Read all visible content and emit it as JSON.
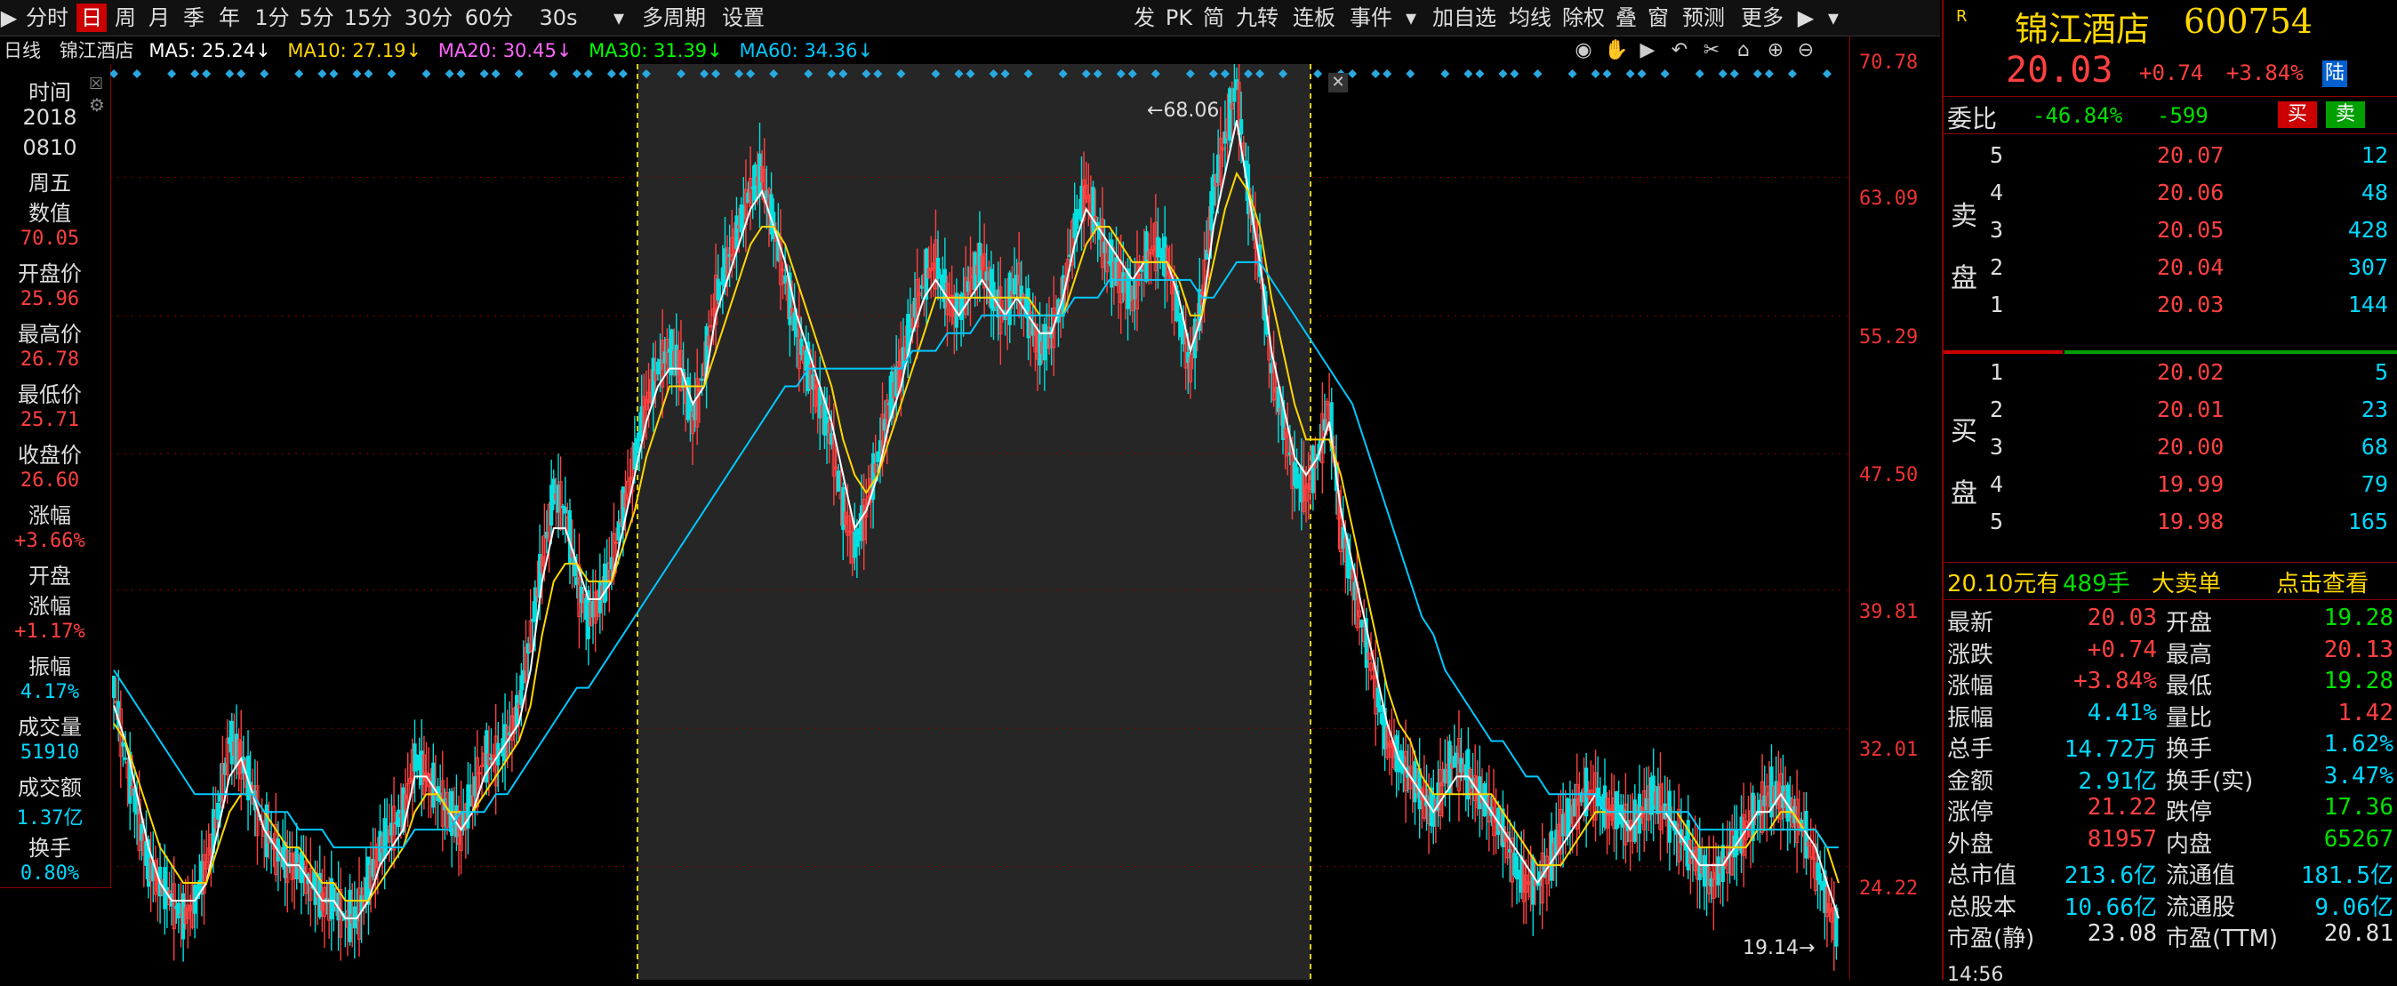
{
  "toolbar": {
    "items": [
      "分时",
      "日",
      "周",
      "月",
      "季",
      "年",
      "1分",
      "5分",
      "15分",
      "30分",
      "60分",
      "30s",
      "多周期",
      "设置"
    ],
    "dropdown": "▾",
    "right_items": [
      "发",
      "PK",
      "简",
      "九转",
      "连板",
      "事件",
      "加自选",
      "均线",
      "除权",
      "叠",
      "窗",
      "预测",
      "更多"
    ]
  },
  "ma_row": {
    "period": "日线",
    "name": "锦江酒店",
    "ma5": "MA5: 25.24↓",
    "ma10": "MA10: 27.19↓",
    "ma20": "MA20: 30.45↓",
    "ma30": "MA30: 31.39↓",
    "ma60": "MA60: 34.36↓"
  },
  "info_panel": {
    "rows": [
      {
        "label": "时间",
        "value": ""
      },
      {
        "label": "2018",
        "value": ""
      },
      {
        "label": "0810",
        "value": ""
      },
      {
        "label": "周五",
        "value": ""
      },
      {
        "label": "数值",
        "value": "70.05",
        "color": "#ff4040"
      },
      {
        "label": "开盘价",
        "value": "25.96",
        "color": "#ff4040"
      },
      {
        "label": "最高价",
        "value": "26.78",
        "color": "#ff4040"
      },
      {
        "label": "最低价",
        "value": "25.71",
        "color": "#ff4040"
      },
      {
        "label": "收盘价",
        "value": "26.60",
        "color": "#ff4040"
      },
      {
        "label": "涨幅",
        "value": "+3.66%",
        "color": "#ff4040"
      },
      {
        "label": "开盘",
        "value": ""
      },
      {
        "label": "涨幅",
        "value": "+1.17%",
        "color": "#ff4040"
      },
      {
        "label": "振幅",
        "value": "4.17%",
        "color": "#00d8ff"
      },
      {
        "label": "成交量",
        "value": "51910",
        "color": "#00d8ff"
      },
      {
        "label": "成交额",
        "value": "1.37亿",
        "color": "#00d8ff"
      },
      {
        "label": "换手",
        "value": "0.80%",
        "color": "#00d8ff"
      }
    ]
  },
  "yaxis": {
    "ticks": [
      "70.78",
      "63.09",
      "55.29",
      "47.50",
      "39.81",
      "32.01",
      "24.22"
    ]
  },
  "chart": {
    "high_label": "68.06",
    "low_label": "19.14"
  },
  "quote": {
    "badge": "R",
    "name": "锦江酒店",
    "code": "600754",
    "price": "20.03",
    "change": "+0.74",
    "pct": "+3.84%",
    "tag": "陆",
    "weibi_label": "委比",
    "weibi": "-46.84%",
    "weicha": "-599",
    "buy_btn": "买",
    "sell_btn": "卖",
    "sell_label_1": "卖",
    "sell_label_2": "盘",
    "buy_label_1": "买",
    "buy_label_2": "盘",
    "asks": [
      {
        "lvl": "5",
        "price": "20.07",
        "vol": "12"
      },
      {
        "lvl": "4",
        "price": "20.06",
        "vol": "48"
      },
      {
        "lvl": "3",
        "price": "20.05",
        "vol": "428"
      },
      {
        "lvl": "2",
        "price": "20.04",
        "vol": "307"
      },
      {
        "lvl": "1",
        "price": "20.03",
        "vol": "144"
      }
    ],
    "bids": [
      {
        "lvl": "1",
        "price": "20.02",
        "vol": "5"
      },
      {
        "lvl": "2",
        "price": "20.01",
        "vol": "23"
      },
      {
        "lvl": "3",
        "price": "20.00",
        "vol": "68"
      },
      {
        "lvl": "4",
        "price": "19.99",
        "vol": "79"
      },
      {
        "lvl": "5",
        "price": "19.98",
        "vol": "165"
      }
    ],
    "big_order_price": "20.10元有",
    "big_order_vol": "489手",
    "big_order_text": "大卖单",
    "big_order_link": "点击查看",
    "stats": [
      {
        "l1": "最新",
        "v1": "20.03",
        "c1": "#ff4040",
        "l2": "开盘",
        "v2": "19.28",
        "c2": "#00e000"
      },
      {
        "l1": "涨跌",
        "v1": "+0.74",
        "c1": "#ff4040",
        "l2": "最高",
        "v2": "20.13",
        "c2": "#ff4040"
      },
      {
        "l1": "涨幅",
        "v1": "+3.84%",
        "c1": "#ff4040",
        "l2": "最低",
        "v2": "19.28",
        "c2": "#00e000"
      },
      {
        "l1": "振幅",
        "v1": "4.41%",
        "c1": "#00d8ff",
        "l2": "量比",
        "v2": "1.42",
        "c2": "#ff4040"
      },
      {
        "l1": "总手",
        "v1": "14.72万",
        "c1": "#00d8ff",
        "l2": "换手",
        "v2": "1.62%",
        "c2": "#00d8ff"
      },
      {
        "l1": "金额",
        "v1": "2.91亿",
        "c1": "#00d8ff",
        "l2": "换手(实)",
        "v2": "3.47%",
        "c2": "#00d8ff"
      },
      {
        "l1": "涨停",
        "v1": "21.22",
        "c1": "#ff4040",
        "l2": "跌停",
        "v2": "17.36",
        "c2": "#00e000"
      },
      {
        "l1": "外盘",
        "v1": "81957",
        "c1": "#ff4040",
        "l2": "内盘",
        "v2": "65267",
        "c2": "#00e000"
      },
      {
        "l1": "总市值",
        "v1": "213.6亿",
        "c1": "#00d8ff",
        "l2": "流通值",
        "v2": "181.5亿",
        "c2": "#00d8ff"
      },
      {
        "l1": "总股本",
        "v1": "10.66亿",
        "c1": "#00d8ff",
        "l2": "流通股",
        "v2": "9.06亿",
        "c2": "#00d8ff"
      },
      {
        "l1": "市盈(静)",
        "v1": "23.08",
        "c1": "#e0e0e0",
        "l2": "市盈(TTM)",
        "v2": "20.81",
        "c2": "#e0e0e0"
      }
    ],
    "bottom_time": "14:56"
  },
  "colors": {
    "up": "#ff4040",
    "down": "#00e0e0",
    "ma5": "#ffffff",
    "ma10": "#ffd700",
    "ma20": "#ff66ff",
    "ma30": "#00ff00",
    "ma60": "#00c8ff"
  },
  "chart_data": {
    "type": "line",
    "title": "锦江酒店 日线",
    "ylim": [
      19.14,
      70.78
    ],
    "yticks": [
      70.78,
      63.09,
      55.29,
      47.5,
      39.81,
      32.01,
      24.22
    ],
    "series": [
      {
        "name": "close",
        "values": [
          34,
          30,
          27,
          24,
          23,
          22,
          21,
          22,
          24,
          27,
          31,
          30,
          28,
          26,
          25,
          24,
          24,
          23,
          22,
          22,
          21,
          21,
          23,
          25,
          26,
          27,
          30,
          29,
          28,
          27,
          26,
          28,
          30,
          30,
          31,
          33,
          37,
          41,
          45,
          44,
          40,
          38,
          39,
          41,
          44,
          47,
          50,
          52,
          53,
          52,
          49,
          52,
          56,
          58,
          60,
          62,
          63,
          60,
          57,
          54,
          52,
          50,
          48,
          44,
          42,
          44,
          47,
          50,
          52,
          55,
          57,
          58,
          56,
          55,
          57,
          58,
          56,
          55,
          57,
          55,
          53,
          54,
          56,
          60,
          62,
          60,
          58,
          57,
          56,
          58,
          59,
          58,
          55,
          52,
          56,
          62,
          65,
          68,
          62,
          58,
          52,
          49,
          46,
          45,
          47,
          50,
          43,
          40,
          37,
          34,
          31,
          30,
          29,
          28,
          27,
          29,
          30,
          29,
          28,
          27,
          26,
          24,
          23,
          23,
          24,
          26,
          27,
          28,
          28,
          27,
          27,
          26,
          27,
          28,
          27,
          26,
          25,
          24,
          23,
          24,
          25,
          26,
          27,
          28,
          28,
          27,
          26,
          24,
          22,
          20
        ]
      },
      {
        "name": "MA5",
        "values": [
          33,
          31,
          28,
          25,
          23,
          22,
          22,
          22,
          23,
          26,
          29,
          30,
          28,
          26,
          25,
          24,
          24,
          23,
          22,
          22,
          21,
          21,
          22,
          24,
          25,
          26,
          29,
          29,
          28,
          27,
          26,
          27,
          29,
          30,
          31,
          32,
          35,
          40,
          43,
          43,
          41,
          39,
          39,
          40,
          43,
          46,
          49,
          51,
          52,
          52,
          50,
          51,
          55,
          57,
          59,
          61,
          62,
          60,
          58,
          55,
          53,
          51,
          49,
          46,
          43,
          44,
          46,
          49,
          51,
          54,
          56,
          57,
          56,
          55,
          56,
          57,
          56,
          55,
          56,
          55,
          54,
          54,
          56,
          59,
          61,
          60,
          59,
          58,
          57,
          58,
          58,
          58,
          56,
          53,
          55,
          60,
          63,
          66,
          62,
          58,
          53,
          50,
          47,
          46,
          47,
          49,
          44,
          41,
          38,
          35,
          32,
          30,
          29,
          28,
          27,
          28,
          29,
          29,
          28,
          27,
          26,
          25,
          24,
          23,
          24,
          25,
          26,
          27,
          28,
          27,
          27,
          26,
          27,
          27,
          27,
          26,
          25,
          24,
          24,
          24,
          25,
          26,
          27,
          27,
          28,
          27,
          26,
          25,
          23,
          21
        ]
      },
      {
        "name": "MA10",
        "values": [
          32,
          31,
          29,
          27,
          25,
          24,
          23,
          23,
          23,
          25,
          27,
          28,
          28,
          27,
          26,
          25,
          25,
          24,
          23,
          23,
          22,
          22,
          22,
          23,
          24,
          25,
          27,
          28,
          28,
          27,
          27,
          27,
          28,
          29,
          30,
          31,
          33,
          37,
          40,
          41,
          41,
          40,
          40,
          40,
          42,
          44,
          47,
          49,
          51,
          51,
          51,
          51,
          53,
          55,
          57,
          59,
          60,
          60,
          59,
          57,
          55,
          53,
          51,
          48,
          46,
          45,
          46,
          48,
          50,
          52,
          54,
          56,
          56,
          56,
          56,
          56,
          56,
          56,
          56,
          56,
          55,
          55,
          55,
          57,
          59,
          60,
          60,
          59,
          58,
          58,
          58,
          58,
          57,
          55,
          55,
          58,
          61,
          63,
          62,
          60,
          56,
          53,
          50,
          48,
          48,
          48,
          46,
          43,
          40,
          37,
          34,
          32,
          31,
          29,
          28,
          28,
          28,
          28,
          28,
          28,
          27,
          26,
          25,
          24,
          24,
          24,
          25,
          26,
          27,
          27,
          27,
          27,
          27,
          27,
          27,
          27,
          26,
          25,
          25,
          25,
          25,
          25,
          26,
          26,
          27,
          27,
          26,
          26,
          25,
          23
        ]
      },
      {
        "name": "MA60",
        "values": [
          35,
          34,
          33,
          32,
          31,
          30,
          29,
          28,
          28,
          28,
          28,
          28,
          28,
          27,
          27,
          27,
          26,
          26,
          26,
          25,
          25,
          25,
          25,
          25,
          25,
          25,
          26,
          26,
          26,
          26,
          27,
          27,
          27,
          28,
          28,
          29,
          30,
          31,
          32,
          33,
          34,
          34,
          35,
          36,
          37,
          38,
          39,
          40,
          41,
          42,
          43,
          44,
          45,
          46,
          47,
          48,
          49,
          50,
          51,
          51,
          52,
          52,
          52,
          52,
          52,
          52,
          52,
          52,
          52,
          53,
          53,
          53,
          54,
          54,
          54,
          55,
          55,
          55,
          55,
          55,
          55,
          55,
          55,
          56,
          56,
          56,
          57,
          57,
          57,
          57,
          57,
          57,
          57,
          57,
          56,
          56,
          57,
          58,
          58,
          58,
          57,
          56,
          55,
          54,
          53,
          52,
          51,
          50,
          48,
          46,
          44,
          42,
          40,
          38,
          37,
          35,
          34,
          33,
          32,
          31,
          31,
          30,
          29,
          29,
          28,
          28,
          28,
          28,
          28,
          27,
          27,
          27,
          27,
          27,
          27,
          27,
          27,
          26,
          26,
          26,
          26,
          26,
          26,
          26,
          26,
          26,
          26,
          26,
          25,
          25
        ]
      }
    ]
  }
}
